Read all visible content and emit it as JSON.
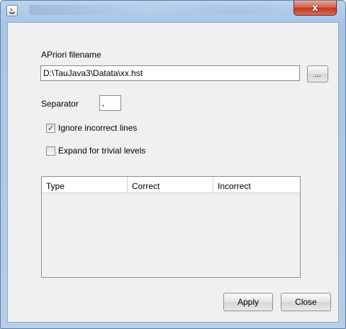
{
  "window": {
    "close_glyph": "x"
  },
  "form": {
    "filename_label": "APriori filename",
    "filename_value": "D:\\TauJava3\\Datata\\xx.hst",
    "browse_label": "...",
    "separator_label": "Separator",
    "separator_value": ",",
    "ignore_label": "Ignore incorrect lines",
    "ignore_checked": true,
    "expand_label": "Expand for trivial levels",
    "expand_checked": false
  },
  "table": {
    "columns": [
      "Type",
      "Correct",
      "Incorrect"
    ],
    "rows": []
  },
  "buttons": {
    "apply": "Apply",
    "close": "Close"
  }
}
